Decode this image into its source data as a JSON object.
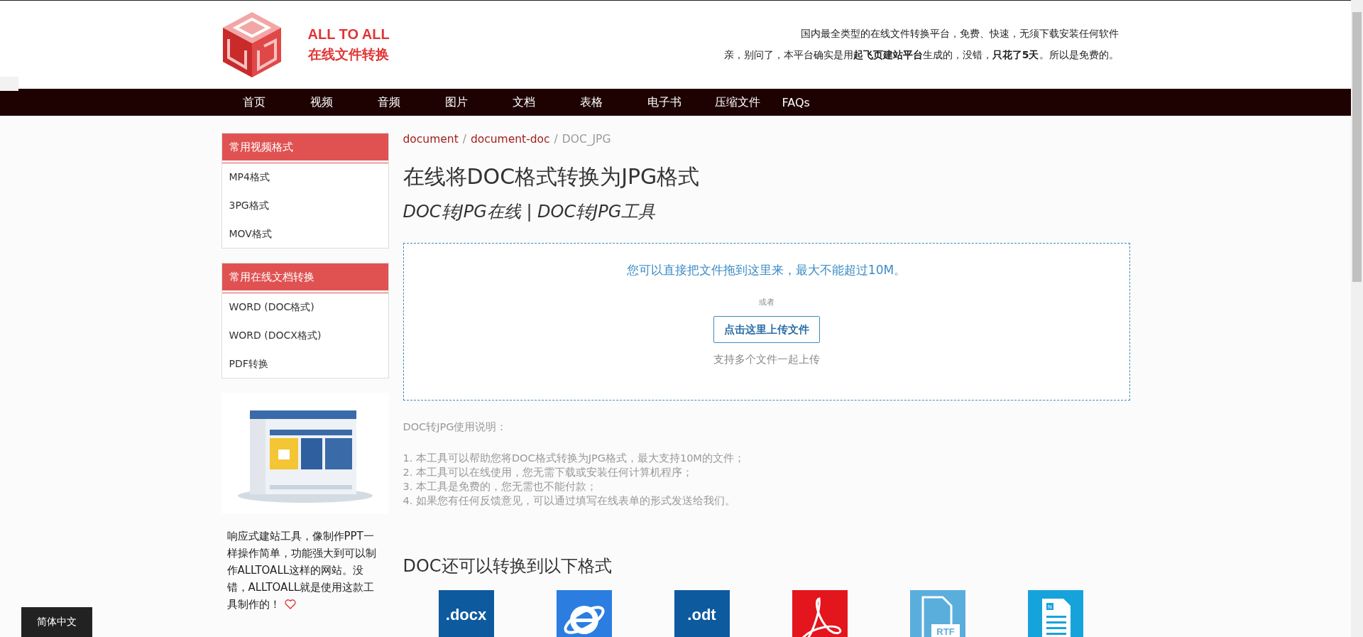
{
  "brand": {
    "name": "ALL TO ALL",
    "tagline": "在线文件转换"
  },
  "header_notes": {
    "line1": "国内最全类型的在线文件转换平台，免费、快速，无须下载安装任何软件",
    "line2": "亲，别问了，本平台确实是用**起飞页建站平台**生成的，没错，**只花了5天**。所以是免费的。"
  },
  "nav": [
    "首页",
    "视频",
    "音频",
    "图片",
    "文档",
    "表格",
    "电子书",
    "压缩文件",
    "FAQs"
  ],
  "sidebar": {
    "panels": [
      {
        "title": "常用视频格式",
        "items": [
          "MP4格式",
          "3PG格式",
          "MOV格式"
        ]
      },
      {
        "title": "常用在线文档转换",
        "items": [
          "WORD (DOC格式)",
          "WORD (DOCX格式)",
          "PDF转换"
        ]
      }
    ],
    "promo": {
      "text": "响应式建站工具，像制作PPT一样操作简单，功能强大到可以制作ALLTOALL这样的网站。没错，ALLTOALL就是使用这款工具制作的！"
    }
  },
  "breadcrumb": [
    {
      "kind": "link",
      "label": "document"
    },
    {
      "kind": "separator",
      "label": "/"
    },
    {
      "kind": "link",
      "label": "document-doc"
    },
    {
      "kind": "separator",
      "label": "/"
    },
    {
      "kind": "current",
      "label": "DOC_JPG"
    }
  ],
  "title": "在线将DOC格式转换为JPG格式",
  "subtitle": "DOC转JPG在线 | DOC转JPG工具",
  "upload": {
    "drop_hint": "您可以直接把文件拖到这里来，最大不能超过10M。",
    "or": "或者",
    "button": "点击这里上传文件",
    "note": "支持多个文件一起上传"
  },
  "instructions": {
    "heading": "DOC转JPG使用说明：",
    "items": [
      "1. 本工具可以帮助您将DOC格式转换为JPG格式，最大支持10M的文件；",
      "2. 本工具可以在线使用，您无需下载或安装任何计算机程序；",
      "3. 本工具是免费的，您无需也不能付款；",
      "4. 如果您有任何反馈意见，可以通过填写在线表单的形式发送给我们。"
    ]
  },
  "formats": {
    "heading": "DOC还可以转换到以下格式",
    "items": [
      {
        "kind": "tile",
        "label": ".docx"
      },
      {
        "kind": "browser"
      },
      {
        "kind": "tile",
        "label": ".odt"
      },
      {
        "kind": "pdf"
      },
      {
        "kind": "rtf",
        "label": "RTF"
      },
      {
        "kind": "document",
        "label": "N"
      }
    ]
  },
  "language_button": "简体中文"
}
